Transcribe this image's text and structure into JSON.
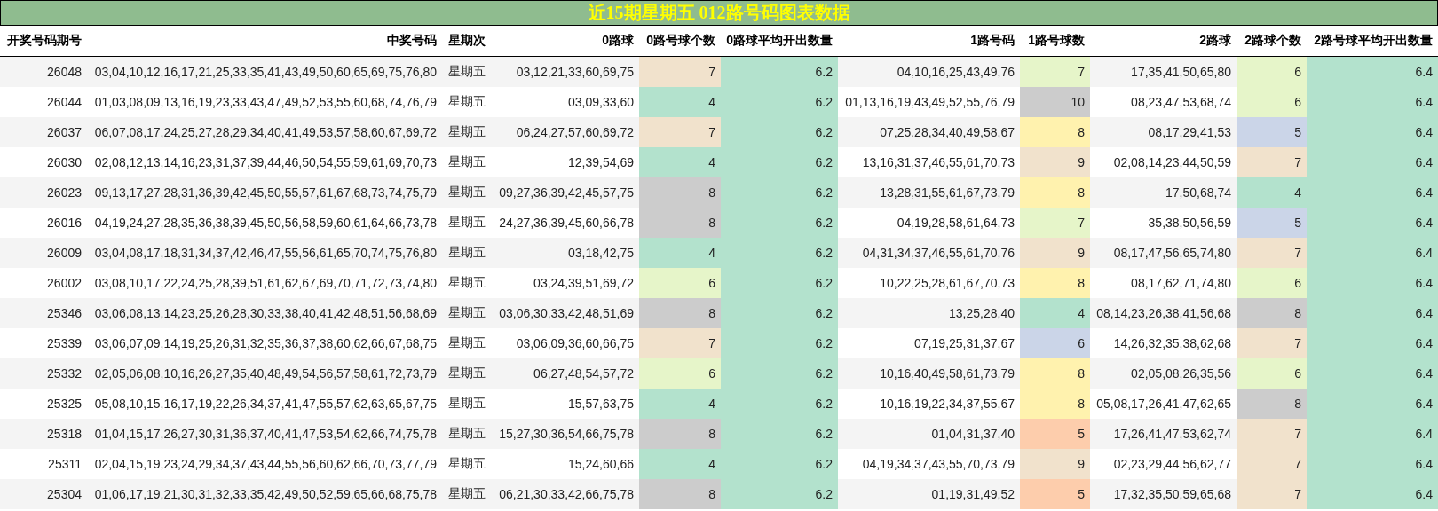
{
  "title": "近15期星期五 012路号码图表数据",
  "columns": [
    "开奖号码期号",
    "中奖号码",
    "星期次",
    "0路球",
    "0路号球个数",
    "0路球平均开出数量",
    "1路号码",
    "1路号球数",
    "2路球",
    "2路球个数",
    "2路号球平均开出数量"
  ],
  "rows": [
    {
      "issue": "26048",
      "numbers": "03,04,10,12,16,17,21,25,33,35,41,43,49,50,60,65,69,75,76,80",
      "weekday": "星期五",
      "r0": "03,12,21,33,60,69,75",
      "r0_count": {
        "value": "7",
        "color": "#f1e2cc"
      },
      "r0_avg": "6.2",
      "r1": "04,10,16,25,43,49,76",
      "r1_count": {
        "value": "7",
        "color": "#e6f5c9"
      },
      "r2": "17,35,41,50,65,80",
      "r2_count": {
        "value": "6",
        "color": "#e6f5c9"
      },
      "r2_avg": "6.4"
    },
    {
      "issue": "26044",
      "numbers": "01,03,08,09,13,16,19,23,33,43,47,49,52,53,55,60,68,74,76,79",
      "weekday": "星期五",
      "r0": "03,09,33,60",
      "r0_count": {
        "value": "4",
        "color": "#b3e2cd"
      },
      "r0_avg": "6.2",
      "r1": "01,13,16,19,43,49,52,55,76,79",
      "r1_count": {
        "value": "10",
        "color": "#cccccc"
      },
      "r2": "08,23,47,53,68,74",
      "r2_count": {
        "value": "6",
        "color": "#e6f5c9"
      },
      "r2_avg": "6.4"
    },
    {
      "issue": "26037",
      "numbers": "06,07,08,17,24,25,27,28,29,34,40,41,49,53,57,58,60,67,69,72",
      "weekday": "星期五",
      "r0": "06,24,27,57,60,69,72",
      "r0_count": {
        "value": "7",
        "color": "#f1e2cc"
      },
      "r0_avg": "6.2",
      "r1": "07,25,28,34,40,49,58,67",
      "r1_count": {
        "value": "8",
        "color": "#fff2ae"
      },
      "r2": "08,17,29,41,53",
      "r2_count": {
        "value": "5",
        "color": "#cbd5e8"
      },
      "r2_avg": "6.4"
    },
    {
      "issue": "26030",
      "numbers": "02,08,12,13,14,16,23,31,37,39,44,46,50,54,55,59,61,69,70,73",
      "weekday": "星期五",
      "r0": "12,39,54,69",
      "r0_count": {
        "value": "4",
        "color": "#b3e2cd"
      },
      "r0_avg": "6.2",
      "r1": "13,16,31,37,46,55,61,70,73",
      "r1_count": {
        "value": "9",
        "color": "#f1e2cc"
      },
      "r2": "02,08,14,23,44,50,59",
      "r2_count": {
        "value": "7",
        "color": "#f1e2cc"
      },
      "r2_avg": "6.4"
    },
    {
      "issue": "26023",
      "numbers": "09,13,17,27,28,31,36,39,42,45,50,55,57,61,67,68,73,74,75,79",
      "weekday": "星期五",
      "r0": "09,27,36,39,42,45,57,75",
      "r0_count": {
        "value": "8",
        "color": "#cccccc"
      },
      "r0_avg": "6.2",
      "r1": "13,28,31,55,61,67,73,79",
      "r1_count": {
        "value": "8",
        "color": "#fff2ae"
      },
      "r2": "17,50,68,74",
      "r2_count": {
        "value": "4",
        "color": "#b3e2cd"
      },
      "r2_avg": "6.4"
    },
    {
      "issue": "26016",
      "numbers": "04,19,24,27,28,35,36,38,39,45,50,56,58,59,60,61,64,66,73,78",
      "weekday": "星期五",
      "r0": "24,27,36,39,45,60,66,78",
      "r0_count": {
        "value": "8",
        "color": "#cccccc"
      },
      "r0_avg": "6.2",
      "r1": "04,19,28,58,61,64,73",
      "r1_count": {
        "value": "7",
        "color": "#e6f5c9"
      },
      "r2": "35,38,50,56,59",
      "r2_count": {
        "value": "5",
        "color": "#cbd5e8"
      },
      "r2_avg": "6.4"
    },
    {
      "issue": "26009",
      "numbers": "03,04,08,17,18,31,34,37,42,46,47,55,56,61,65,70,74,75,76,80",
      "weekday": "星期五",
      "r0": "03,18,42,75",
      "r0_count": {
        "value": "4",
        "color": "#b3e2cd"
      },
      "r0_avg": "6.2",
      "r1": "04,31,34,37,46,55,61,70,76",
      "r1_count": {
        "value": "9",
        "color": "#f1e2cc"
      },
      "r2": "08,17,47,56,65,74,80",
      "r2_count": {
        "value": "7",
        "color": "#f1e2cc"
      },
      "r2_avg": "6.4"
    },
    {
      "issue": "26002",
      "numbers": "03,08,10,17,22,24,25,28,39,51,61,62,67,69,70,71,72,73,74,80",
      "weekday": "星期五",
      "r0": "03,24,39,51,69,72",
      "r0_count": {
        "value": "6",
        "color": "#e6f5c9"
      },
      "r0_avg": "6.2",
      "r1": "10,22,25,28,61,67,70,73",
      "r1_count": {
        "value": "8",
        "color": "#fff2ae"
      },
      "r2": "08,17,62,71,74,80",
      "r2_count": {
        "value": "6",
        "color": "#e6f5c9"
      },
      "r2_avg": "6.4"
    },
    {
      "issue": "25346",
      "numbers": "03,06,08,13,14,23,25,26,28,30,33,38,40,41,42,48,51,56,68,69",
      "weekday": "星期五",
      "r0": "03,06,30,33,42,48,51,69",
      "r0_count": {
        "value": "8",
        "color": "#cccccc"
      },
      "r0_avg": "6.2",
      "r1": "13,25,28,40",
      "r1_count": {
        "value": "4",
        "color": "#b3e2cd"
      },
      "r2": "08,14,23,26,38,41,56,68",
      "r2_count": {
        "value": "8",
        "color": "#cccccc"
      },
      "r2_avg": "6.4"
    },
    {
      "issue": "25339",
      "numbers": "03,06,07,09,14,19,25,26,31,32,35,36,37,38,60,62,66,67,68,75",
      "weekday": "星期五",
      "r0": "03,06,09,36,60,66,75",
      "r0_count": {
        "value": "7",
        "color": "#f1e2cc"
      },
      "r0_avg": "6.2",
      "r1": "07,19,25,31,37,67",
      "r1_count": {
        "value": "6",
        "color": "#cbd5e8"
      },
      "r2": "14,26,32,35,38,62,68",
      "r2_count": {
        "value": "7",
        "color": "#f1e2cc"
      },
      "r2_avg": "6.4"
    },
    {
      "issue": "25332",
      "numbers": "02,05,06,08,10,16,26,27,35,40,48,49,54,56,57,58,61,72,73,79",
      "weekday": "星期五",
      "r0": "06,27,48,54,57,72",
      "r0_count": {
        "value": "6",
        "color": "#e6f5c9"
      },
      "r0_avg": "6.2",
      "r1": "10,16,40,49,58,61,73,79",
      "r1_count": {
        "value": "8",
        "color": "#fff2ae"
      },
      "r2": "02,05,08,26,35,56",
      "r2_count": {
        "value": "6",
        "color": "#e6f5c9"
      },
      "r2_avg": "6.4"
    },
    {
      "issue": "25325",
      "numbers": "05,08,10,15,16,17,19,22,26,34,37,41,47,55,57,62,63,65,67,75",
      "weekday": "星期五",
      "r0": "15,57,63,75",
      "r0_count": {
        "value": "4",
        "color": "#b3e2cd"
      },
      "r0_avg": "6.2",
      "r1": "10,16,19,22,34,37,55,67",
      "r1_count": {
        "value": "8",
        "color": "#fff2ae"
      },
      "r2": "05,08,17,26,41,47,62,65",
      "r2_count": {
        "value": "8",
        "color": "#cccccc"
      },
      "r2_avg": "6.4"
    },
    {
      "issue": "25318",
      "numbers": "01,04,15,17,26,27,30,31,36,37,40,41,47,53,54,62,66,74,75,78",
      "weekday": "星期五",
      "r0": "15,27,30,36,54,66,75,78",
      "r0_count": {
        "value": "8",
        "color": "#cccccc"
      },
      "r0_avg": "6.2",
      "r1": "01,04,31,37,40",
      "r1_count": {
        "value": "5",
        "color": "#fdcdac"
      },
      "r2": "17,26,41,47,53,62,74",
      "r2_count": {
        "value": "7",
        "color": "#f1e2cc"
      },
      "r2_avg": "6.4"
    },
    {
      "issue": "25311",
      "numbers": "02,04,15,19,23,24,29,34,37,43,44,55,56,60,62,66,70,73,77,79",
      "weekday": "星期五",
      "r0": "15,24,60,66",
      "r0_count": {
        "value": "4",
        "color": "#b3e2cd"
      },
      "r0_avg": "6.2",
      "r1": "04,19,34,37,43,55,70,73,79",
      "r1_count": {
        "value": "9",
        "color": "#f1e2cc"
      },
      "r2": "02,23,29,44,56,62,77",
      "r2_count": {
        "value": "7",
        "color": "#f1e2cc"
      },
      "r2_avg": "6.4"
    },
    {
      "issue": "25304",
      "numbers": "01,06,17,19,21,30,31,32,33,35,42,49,50,52,59,65,66,68,75,78",
      "weekday": "星期五",
      "r0": "06,21,30,33,42,66,75,78",
      "r0_count": {
        "value": "8",
        "color": "#cccccc"
      },
      "r0_avg": "6.2",
      "r1": "01,19,31,49,52",
      "r1_count": {
        "value": "5",
        "color": "#fdcdac"
      },
      "r2": "17,32,35,50,59,65,68",
      "r2_count": {
        "value": "7",
        "color": "#f1e2cc"
      },
      "r2_avg": "6.4"
    }
  ]
}
